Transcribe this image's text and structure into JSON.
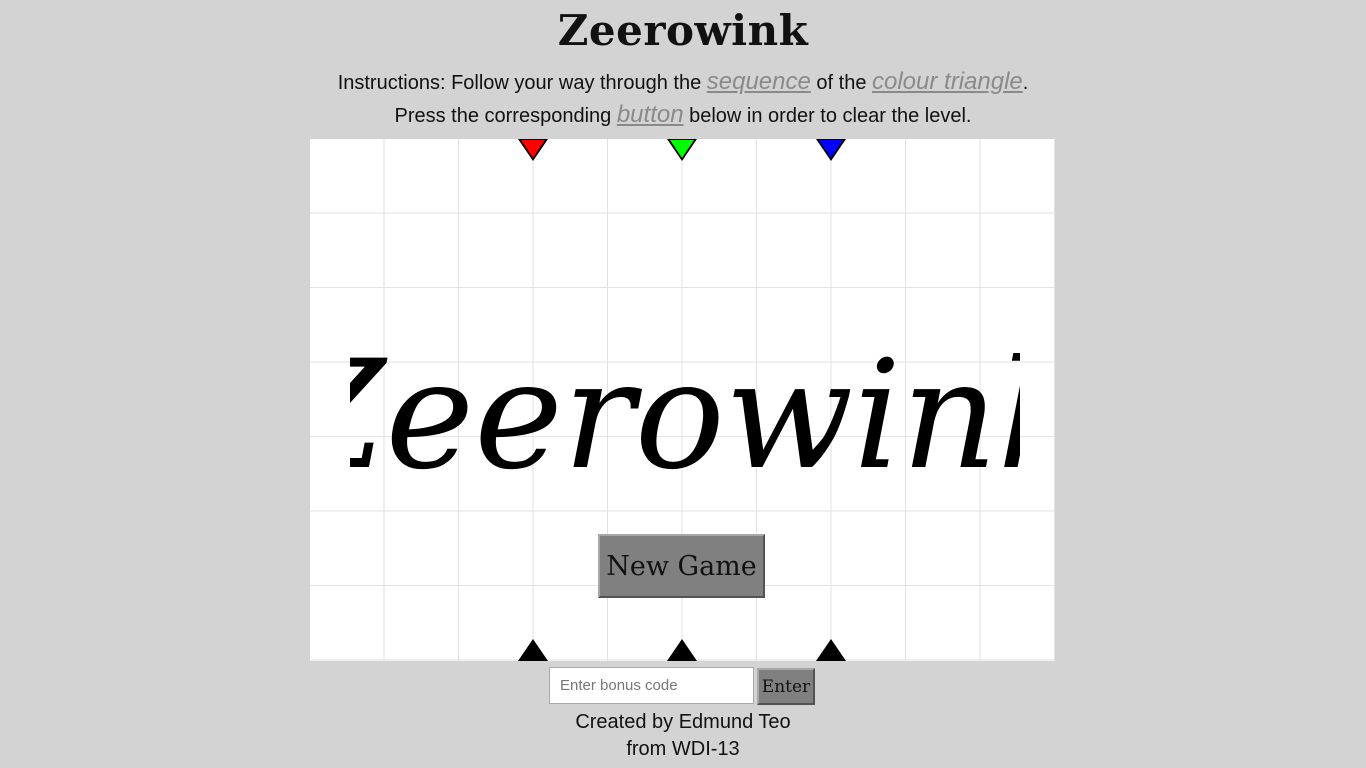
{
  "header": {
    "title": "Zeerowink",
    "instructions_line1_prefix": "Instructions: Follow your way through the ",
    "link_sequence": "sequence",
    "instructions_line1_mid": " of the ",
    "link_colour_triangle": "colour triangle",
    "instructions_line1_suffix": ".",
    "instructions_line2_prefix": "Press the corresponding ",
    "link_button": "button",
    "instructions_line2_suffix": " below in order to clear the level."
  },
  "board": {
    "logo_text": "Zeerowink",
    "top_triangles": [
      {
        "color": "#ff0000",
        "icon": "red-triangle-icon"
      },
      {
        "color": "#00ff00",
        "icon": "green-triangle-icon"
      },
      {
        "color": "#0000ff",
        "icon": "blue-triangle-icon"
      }
    ],
    "bottom_triangles": [
      {
        "color": "#000000",
        "icon": "black-triangle-button-icon"
      },
      {
        "color": "#000000",
        "icon": "black-triangle-button-icon"
      },
      {
        "color": "#000000",
        "icon": "black-triangle-button-icon"
      }
    ],
    "new_game_label": "New Game"
  },
  "bonus": {
    "placeholder": "Enter bonus code",
    "value": "",
    "enter_label": "Enter"
  },
  "footer": {
    "line1": "Created by Edmund Teo",
    "line2": "from WDI-13"
  },
  "colors": {
    "page_background": "#d3d3d3",
    "board_background": "#ffffff",
    "grid_line": "#e2e2e2",
    "button_gray": "#808080",
    "link_gray": "#8a8a8a"
  }
}
